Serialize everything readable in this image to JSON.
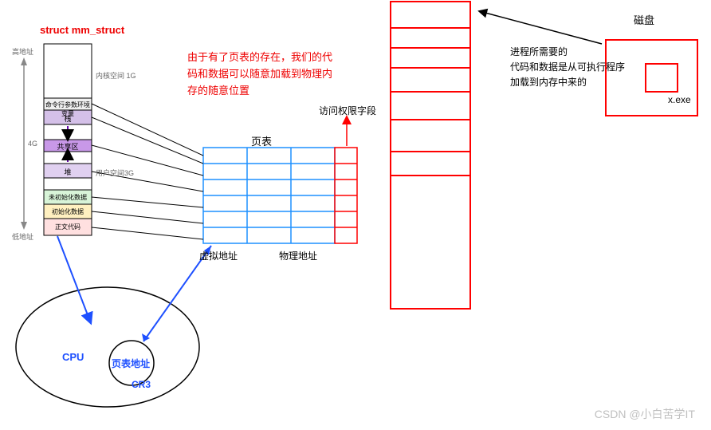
{
  "title": "struct mm_struct",
  "axis": {
    "high": "高地址",
    "low": "低地址"
  },
  "kernel_space": "内核空间 1G",
  "user_space": "用户空间3G",
  "size_4g": "4G",
  "segments": {
    "cmdline": "命令行参数环境变量",
    "stack": "栈",
    "shared": "共享区",
    "heap": "堆",
    "bss": "未初始化数据",
    "data": "初始化数据",
    "text": "正文代码"
  },
  "cpu_label": "CPU",
  "page_table_addr": "页表地址",
  "cr3": "CR3",
  "page_table_title": "页表",
  "vaddr_label": "虚拟地址",
  "paddr_label": "物理地址",
  "perm_label": "访问权限字段",
  "note1_l1": "由于有了页表的存在，我们的代",
  "note1_l2": "码和数据可以随意加载到物理内",
  "note1_l3": "存的随意位置",
  "note2_l1": "进程所需要的",
  "note2_l2": "代码和数据是从可执行程序",
  "note2_l3": "加载到内存中来的",
  "disk_label": "磁盘",
  "exe_label": "x.exe",
  "watermark": "CSDN @小白苦学IT"
}
